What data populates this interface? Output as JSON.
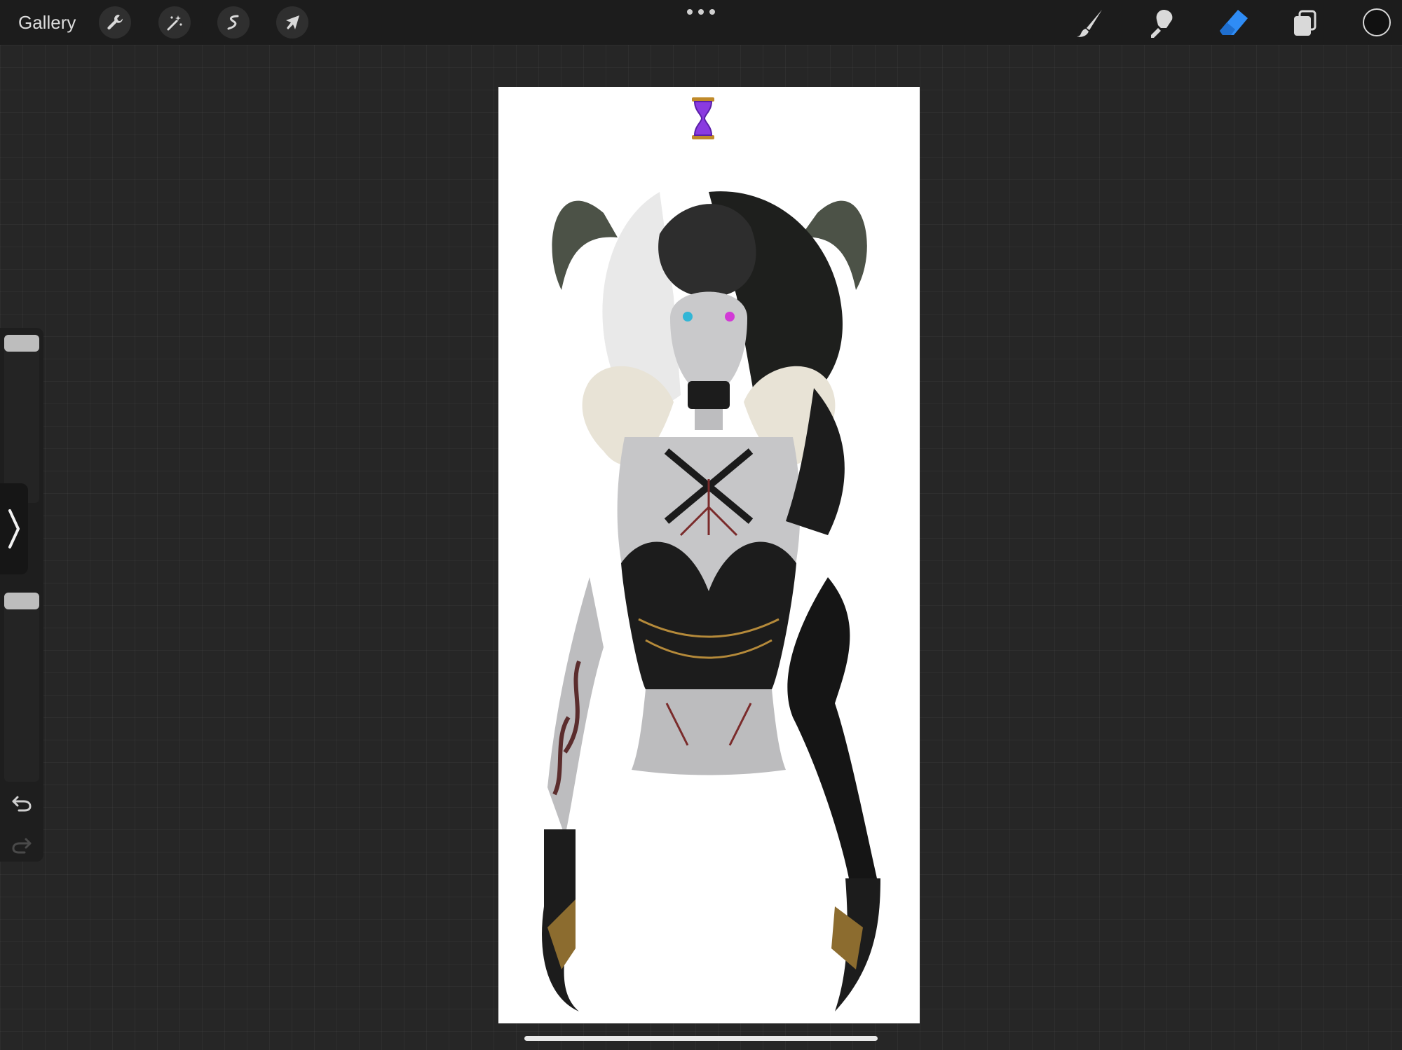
{
  "topbar": {
    "gallery_label": "Gallery",
    "left_tools": [
      {
        "name": "actions",
        "icon": "wrench-icon"
      },
      {
        "name": "adjustments",
        "icon": "magic-wand-icon"
      },
      {
        "name": "selection",
        "icon": "selection-icon"
      },
      {
        "name": "transform",
        "icon": "arrow-cursor-icon"
      }
    ],
    "right_tools": [
      {
        "name": "brush",
        "icon": "brush-icon",
        "active": false
      },
      {
        "name": "smudge",
        "icon": "smudge-icon",
        "active": false
      },
      {
        "name": "eraser",
        "icon": "eraser-icon",
        "active": true
      },
      {
        "name": "layers",
        "icon": "layers-icon",
        "active": false
      }
    ],
    "active_color": "#111111",
    "accent_color": "#2f8cf5"
  },
  "sidebar": {
    "brush_size_level": 0.98,
    "opacity_level": 0.98,
    "undo_icon": "undo-icon",
    "redo_icon": "redo-icon",
    "modify_icon": "chevron-right-icon"
  },
  "canvas": {
    "background": "#ffffff",
    "artwork": "character-illustration",
    "indicator_icon": "hourglass-icon"
  }
}
